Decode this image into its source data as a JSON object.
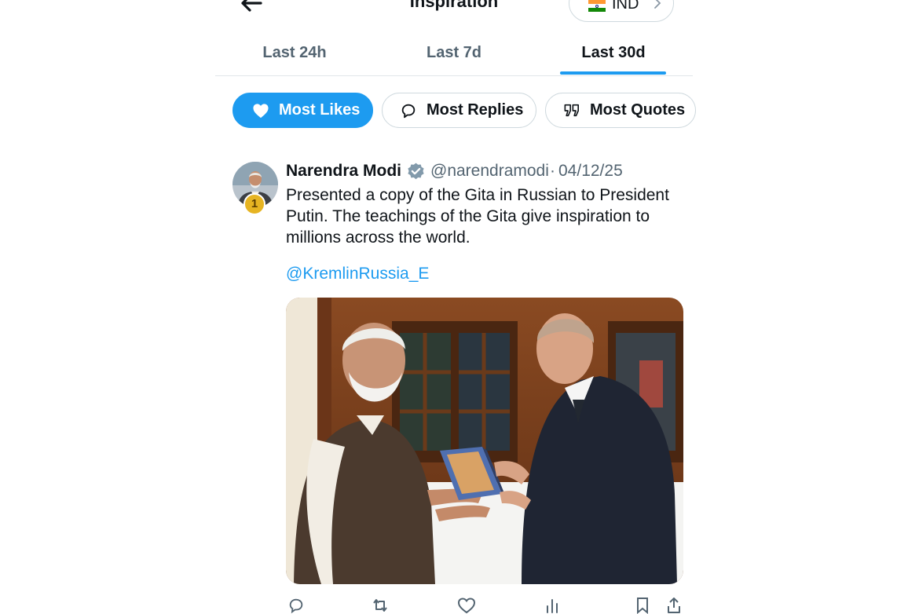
{
  "header": {
    "title": "Inspiration",
    "region_code": "IND"
  },
  "time_tabs": [
    {
      "label": "Last 24h",
      "active": false
    },
    {
      "label": "Last 7d",
      "active": false
    },
    {
      "label": "Last 30d",
      "active": true
    }
  ],
  "sort_chips": [
    {
      "label": "Most Likes",
      "icon": "heart-icon",
      "active": true
    },
    {
      "label": "Most Replies",
      "icon": "speech-bubble-icon",
      "active": false
    },
    {
      "label": "Most Quotes",
      "icon": "quote-icon",
      "active": false
    }
  ],
  "post": {
    "rank": "1",
    "author_name": "Narendra Modi",
    "handle": "@narendramodi",
    "separator": "·",
    "date": "04/12/25",
    "text": "Presented a copy of the Gita in Russian to President Putin. The teachings of the Gita give inspiration to millions across the world.",
    "mention": "@KremlinRussia_E",
    "image_description_icon": "photo-two-men-holding-book"
  },
  "colors": {
    "accent": "#1d9bf0",
    "text_primary": "#0f1419",
    "text_secondary": "#536471",
    "border": "#cfd9de",
    "rank_badge": "#e6b422"
  }
}
